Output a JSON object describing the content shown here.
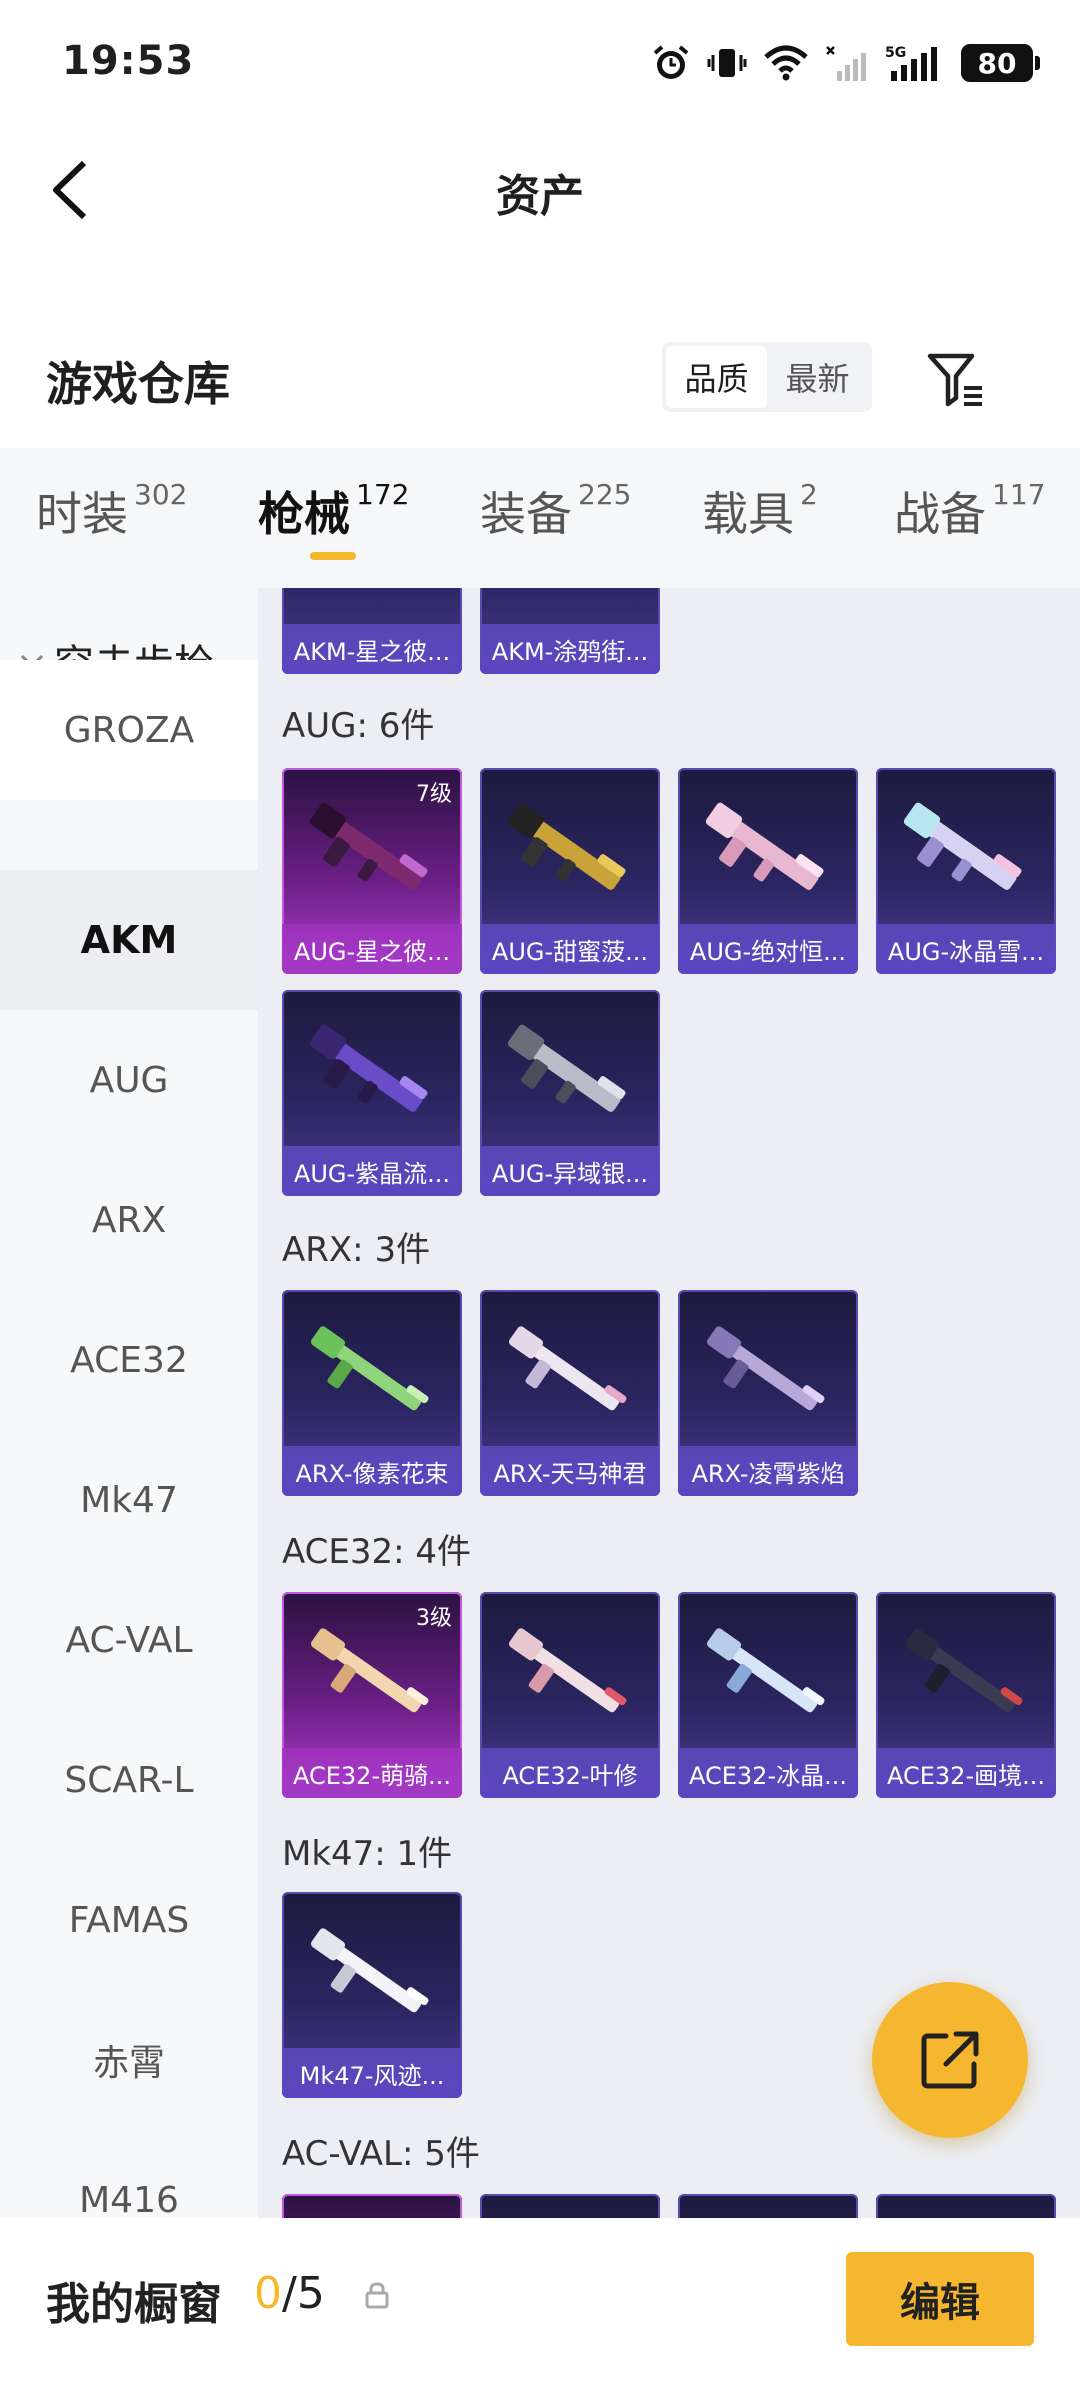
{
  "status_bar": {
    "time": "19:53",
    "battery": "80",
    "network": "5G"
  },
  "header": {
    "title": "资产",
    "back_icon": "chevron-left-icon"
  },
  "warehouse": {
    "title": "游戏仓库",
    "sort_options": [
      "品质",
      "最新"
    ],
    "active_sort": "品质",
    "filter_icon": "filter-icon"
  },
  "tabs": [
    {
      "label": "时装",
      "count": "302"
    },
    {
      "label": "枪械",
      "count": "172",
      "active": true
    },
    {
      "label": "装备",
      "count": "225"
    },
    {
      "label": "载具",
      "count": "2"
    },
    {
      "label": "战备",
      "count": "117"
    }
  ],
  "sidebar": {
    "group": "突击步枪",
    "items": [
      "GROZA",
      "AKM",
      "AUG",
      "ARX",
      "ACE32",
      "Mk47",
      "AC-VAL",
      "SCAR-L",
      "FAMAS",
      "赤霄",
      "M416"
    ],
    "active": "AKM"
  },
  "sections": {
    "akm_partial": [
      {
        "name": "AKM-星之彼...",
        "tier": "blue"
      },
      {
        "name": "AKM-涂鸦街...",
        "tier": "blue"
      }
    ],
    "aug": {
      "title": "AUG: 6件",
      "items": [
        {
          "name": "AUG-星之彼...",
          "tier": "purple",
          "level": "7级"
        },
        {
          "name": "AUG-甜蜜菠...",
          "tier": "blue"
        },
        {
          "name": "AUG-绝对恒...",
          "tier": "blue"
        },
        {
          "name": "AUG-冰晶雪...",
          "tier": "blue"
        },
        {
          "name": "AUG-紫晶流...",
          "tier": "blue"
        },
        {
          "name": "AUG-异域银...",
          "tier": "blue"
        }
      ]
    },
    "arx": {
      "title": "ARX: 3件",
      "items": [
        {
          "name": "ARX-像素花束",
          "tier": "blue"
        },
        {
          "name": "ARX-天马神君",
          "tier": "blue"
        },
        {
          "name": "ARX-凌霄紫焰",
          "tier": "blue"
        }
      ]
    },
    "ace32": {
      "title": "ACE32: 4件",
      "items": [
        {
          "name": "ACE32-萌骑...",
          "tier": "purple",
          "level": "3级"
        },
        {
          "name": "ACE32-叶修",
          "tier": "blue"
        },
        {
          "name": "ACE32-冰晶...",
          "tier": "blue"
        },
        {
          "name": "ACE32-画境...",
          "tier": "blue"
        }
      ]
    },
    "mk47": {
      "title": "Mk47: 1件",
      "items": [
        {
          "name": "Mk47-风迹...",
          "tier": "blue"
        }
      ]
    },
    "acval": {
      "title": "AC-VAL: 5件"
    }
  },
  "fab": {
    "icon": "share-external-icon"
  },
  "bottom_bar": {
    "label": "我的橱窗",
    "count_current": "0",
    "count_total": "/5",
    "lock_icon": "lock-icon",
    "edit_label": "编辑"
  },
  "colors": {
    "accent": "#f6b730",
    "card_blue": "#5b45c0",
    "card_purple": "#a23ac6"
  }
}
